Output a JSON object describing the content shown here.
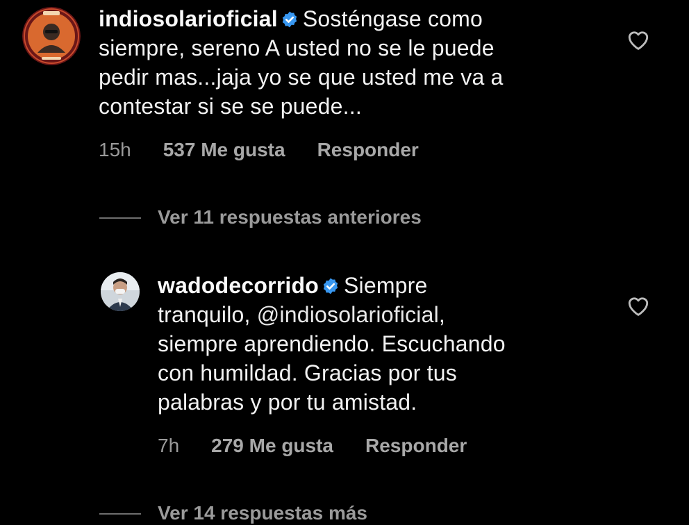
{
  "comments": [
    {
      "username": "indiosolarioficial",
      "text": "Sosténgase como",
      "lines": [
        "siempre, sereno A usted no se le puede",
        "pedir mas...jaja yo se que usted me va a",
        "contestar si se se puede..."
      ],
      "time": "15h",
      "likes": "537 Me gusta",
      "reply": "Responder",
      "avatar_ring_color": "#7a1e1e",
      "avatar_bg_color": "#e07a3c"
    },
    {
      "username": "wadodecorrido",
      "text": "Siempre",
      "line2_prefix": "tranquilo, ",
      "mention": "@indiosolarioficial",
      "line2_suffix": ",",
      "lines": [
        "siempre aprendiendo. Escuchando",
        "con humildad. Gracias por tus",
        "palabras y por tu amistad."
      ],
      "time": "7h",
      "likes": "279 Me gusta",
      "reply": "Responder"
    }
  ],
  "view_previous": "Ver 11 respuestas anteriores",
  "view_more": "Ver 14 respuestas más",
  "icons": {
    "verified": "verified-badge-icon",
    "like": "heart-outline-icon"
  },
  "colors": {
    "background": "#000000",
    "verified_blue": "#3897f0",
    "meta_gray": "#9a9a9a"
  }
}
